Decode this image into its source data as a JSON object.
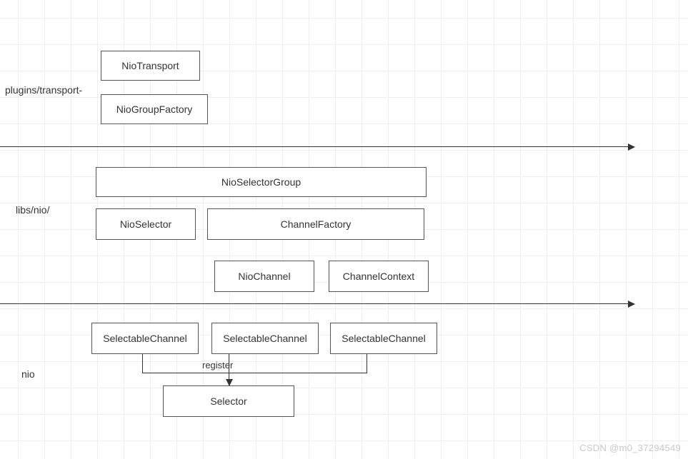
{
  "sections": {
    "plugins": {
      "label": "plugins/transport-"
    },
    "libs": {
      "label": "libs/nio/"
    },
    "nio": {
      "label": "nio"
    }
  },
  "boxes": {
    "nio_transport": "NioTransport",
    "nio_group_factory": "NioGroupFactory",
    "nio_selector_group": "NioSelectorGroup",
    "nio_selector": "NioSelector",
    "channel_factory": "ChannelFactory",
    "nio_channel": "NioChannel",
    "channel_context": "ChannelContext",
    "selectable_channel_1": "SelectableChannel",
    "selectable_channel_2": "SelectableChannel",
    "selectable_channel_3": "SelectableChannel",
    "selector": "Selector"
  },
  "edges": {
    "register": "register"
  },
  "watermark": "CSDN @m0_37294549"
}
